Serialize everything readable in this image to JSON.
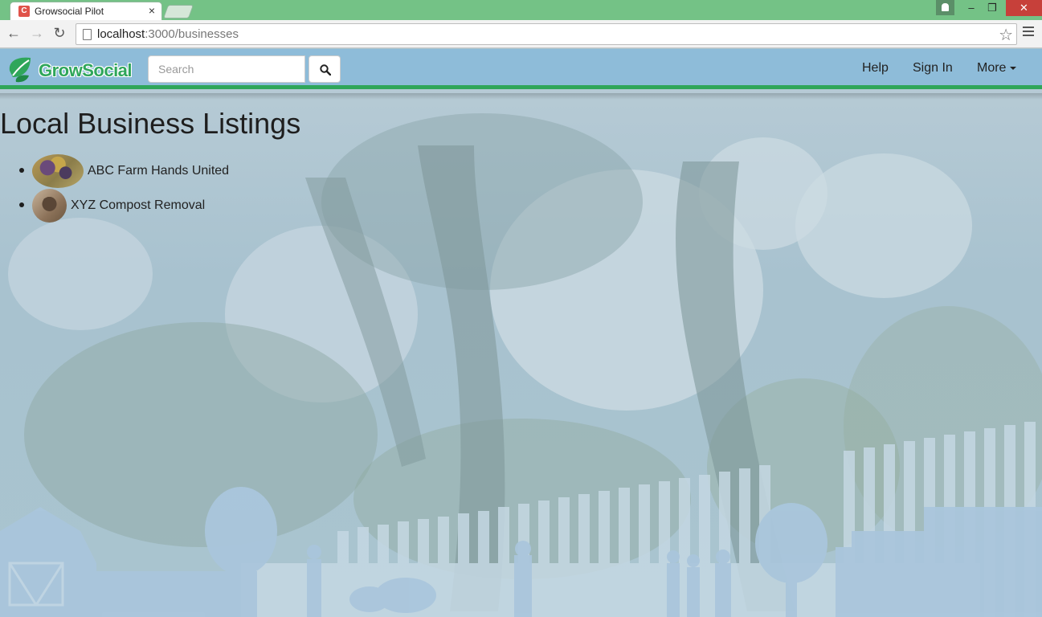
{
  "browser": {
    "tab_title": "Growsocial Pilot",
    "tab_favicon_letter": "C",
    "url_host": "localhost",
    "url_path": ":3000/businesses"
  },
  "navbar": {
    "brand": "GrowSocial",
    "search_placeholder": "Search",
    "links": {
      "help": "Help",
      "sign_in": "Sign In",
      "more": "More"
    }
  },
  "main": {
    "title": "Local Business Listings",
    "listings": [
      {
        "name": "ABC Farm Hands United"
      },
      {
        "name": "XYZ Compost Removal"
      }
    ]
  },
  "colors": {
    "titlebar": "#74c286",
    "navbar": "#8ebcd9",
    "navbar_accent": "#2fa65a",
    "close_button": "#c7403a"
  }
}
